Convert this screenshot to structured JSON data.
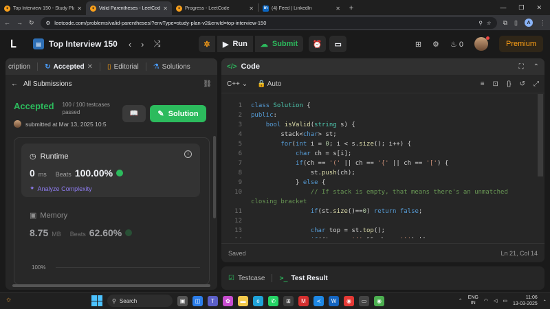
{
  "browser": {
    "tabs": [
      {
        "label": "Top Interview 150 - Study Plan",
        "favicon": "leetcode-icon",
        "active": false
      },
      {
        "label": "Valid Parentheses - LeetCode",
        "favicon": "leetcode-icon",
        "active": true
      },
      {
        "label": "Progress - LeetCode",
        "favicon": "leetcode-icon",
        "active": false
      },
      {
        "label": "(4) Feed | LinkedIn",
        "favicon": "linkedin-icon",
        "active": false
      }
    ],
    "url": "leetcode.com/problems/valid-parentheses/?envType=study-plan-v2&envId=top-interview-150",
    "profile_letter": "A"
  },
  "lc_nav": {
    "plan_title": "Top Interview 150",
    "run_label": "Run",
    "submit_label": "Submit",
    "streak_count": "0",
    "premium_label": "Premium"
  },
  "left_panel": {
    "tabs": [
      {
        "label": "cription"
      },
      {
        "label": "Accepted"
      },
      {
        "label": "Editorial"
      },
      {
        "label": "Solutions"
      }
    ],
    "back_label": "All Submissions",
    "status": "Accepted",
    "testcases": "100 / 100 testcases passed",
    "solution_label": "Solution",
    "submitted_at": "submitted at Mar 13, 2025 10:5",
    "runtime": {
      "title": "Runtime",
      "value": "0",
      "unit": "ms",
      "beats_label": "Beats",
      "beats_value": "100.00%",
      "analyze_label": "Analyze Complexity"
    },
    "memory": {
      "title": "Memory",
      "value": "8.75",
      "unit": "MB",
      "beats_label": "Beats",
      "beats_value": "62.60%"
    },
    "chart_axis_label": "100%"
  },
  "code_panel": {
    "title": "Code",
    "language": "C++",
    "mode": "Auto",
    "status_saved": "Saved",
    "cursor_position": "Ln 21, Col 14",
    "lines": [
      {
        "n": "1",
        "html": "<span class=\"kw\">class</span> <span class=\"ty\">Solution</span> {"
      },
      {
        "n": "2",
        "html": "<span class=\"kw\">public</span>:"
      },
      {
        "n": "3",
        "html": "    <span class=\"kw\">bool</span> <span class=\"fn\">isValid</span>(<span class=\"ty\">string</span> s) {"
      },
      {
        "n": "4",
        "html": "        stack&lt;<span class=\"kw\">char</span>&gt; st;"
      },
      {
        "n": "5",
        "html": "        <span class=\"kw\">for</span>(<span class=\"kw\">int</span> i = <span class=\"nm\">0</span>; i &lt; s.<span class=\"fn\">size</span>(); i++) {"
      },
      {
        "n": "6",
        "html": "            <span class=\"kw\">char</span> ch = s[i];"
      },
      {
        "n": "7",
        "html": "            <span class=\"kw\">if</span>(ch == <span class=\"st\">'('</span> || ch == <span class=\"st\">'{'</span> || ch == <span class=\"st\">'['</span>) {"
      },
      {
        "n": "8",
        "html": "                st.<span class=\"fn\">push</span>(ch);"
      },
      {
        "n": "9",
        "html": "            } <span class=\"kw\">else</span> {"
      },
      {
        "n": "10",
        "html": "                <span class=\"cm\">// If stack is empty, that means there's an unmatched</span>"
      },
      {
        "n": "",
        "html": "<span class=\"cm\">closing bracket</span>",
        "wrap": true
      },
      {
        "n": "11",
        "html": "                <span class=\"kw\">if</span>(st.<span class=\"fn\">size</span>()==<span class=\"nm\">0</span>) <span class=\"kw\">return</span> <span class=\"kw\">false</span>;"
      },
      {
        "n": "12",
        "html": ""
      },
      {
        "n": "13",
        "html": "                <span class=\"kw\">char</span> top = st.<span class=\"fn\">top</span>();"
      },
      {
        "n": "14",
        "html": "                <span class=\"kw\">if</span>((top == <span class=\"st\">'('</span> &amp;&amp; ch == <span class=\"st\">')'</span>) ||"
      }
    ]
  },
  "bottom_panel": {
    "testcase_label": "Testcase",
    "result_label": "Test Result"
  },
  "taskbar": {
    "search_label": "Search",
    "lang_line1": "ENG",
    "lang_line2": "IN",
    "time": "11:06",
    "date": "13-03-2025"
  },
  "colors": {
    "accent_green": "#2cbb5d",
    "premium_orange": "#ffa116",
    "editor_bg": "#262626"
  }
}
